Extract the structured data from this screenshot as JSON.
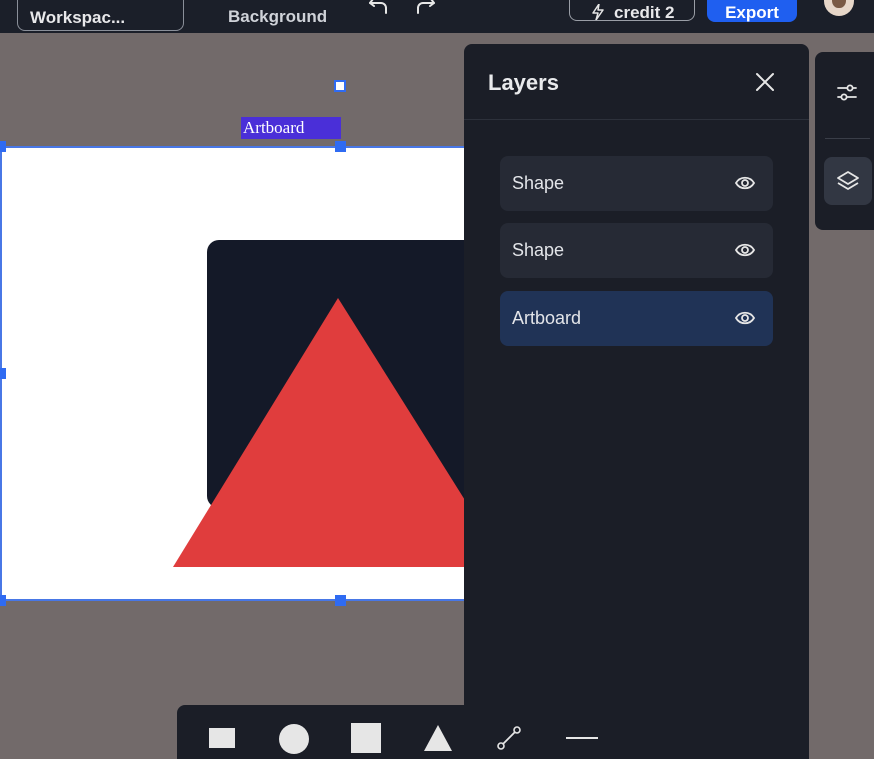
{
  "topbar": {
    "workspace_label": "Workspac...",
    "background_label": "Background",
    "credit_label": "credit 2",
    "export_label": "Export"
  },
  "canvas": {
    "artboard_tag": "Artboard",
    "artboard_color": "#ffffff",
    "shape_rect_color": "#141928",
    "shape_triangle_color": "#e03d3d",
    "selection_color": "#2f6bf2"
  },
  "layers_panel": {
    "title": "Layers",
    "items": [
      {
        "label": "Shape",
        "icon": "eye-icon",
        "active": false
      },
      {
        "label": "Shape",
        "icon": "eye-icon",
        "active": false
      },
      {
        "label": "Artboard",
        "icon": "eye-icon",
        "active": true
      }
    ]
  },
  "side_panel": {
    "icons": [
      "sliders-icon",
      "layers-icon"
    ]
  },
  "toolbar": {
    "tools": [
      "rectangle-tool",
      "circle-tool",
      "square-tool",
      "triangle-tool",
      "path-tool",
      "line-tool"
    ]
  }
}
